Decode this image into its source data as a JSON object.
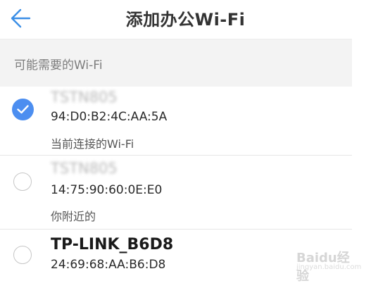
{
  "header": {
    "title": "添加办公Wi-Fi"
  },
  "section": {
    "label": "可能需要的Wi-Fi"
  },
  "networks": [
    {
      "name": "TSTN805",
      "mac": "94:D0:B2:4C:AA:5A",
      "note": "当前连接的Wi-Fi",
      "selected": true
    },
    {
      "name": "TSTN805",
      "mac": "14:75:90:60:0E:E0",
      "note": "你附近的",
      "selected": false
    },
    {
      "name": "TP-LINK_B6D8",
      "mac": "24:69:68:AA:B6:D8",
      "note": "",
      "selected": false
    }
  ],
  "watermark": {
    "text": "Baidu经验",
    "subtext": "jingyan.baidu.com"
  },
  "colors": {
    "accent": "#4c8ef0",
    "section_bg": "#f3f3f3"
  }
}
